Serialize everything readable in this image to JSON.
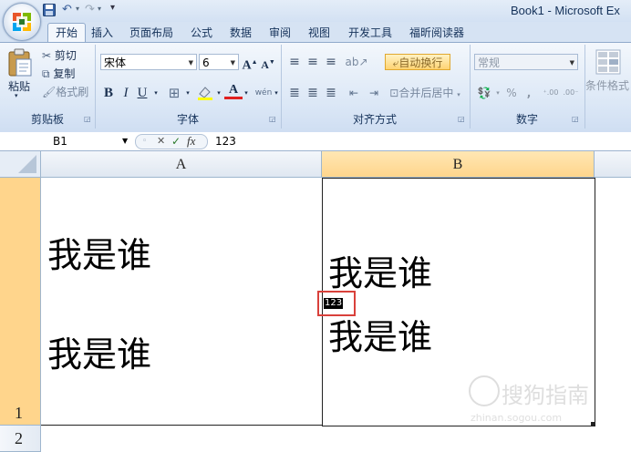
{
  "app": {
    "window_title": "Book1 - Microsoft Ex",
    "quick_access": {
      "undo_arrow": "▾",
      "redo_arrow": "▾",
      "customize": "▾"
    }
  },
  "tabs": [
    {
      "label": "开始"
    },
    {
      "label": "插入"
    },
    {
      "label": "页面布局"
    },
    {
      "label": "公式"
    },
    {
      "label": "数据"
    },
    {
      "label": "审阅"
    },
    {
      "label": "视图"
    },
    {
      "label": "开发工具"
    },
    {
      "label": "福昕阅读器"
    }
  ],
  "ribbon": {
    "clipboard": {
      "paste": "粘贴",
      "cut": "剪切",
      "copy": "复制",
      "format_painter": "格式刷",
      "group_label": "剪贴板"
    },
    "font": {
      "font_name": "宋体",
      "font_size": "6",
      "grow": "A",
      "shrink": "A",
      "bold": "B",
      "italic": "I",
      "underline": "U",
      "wen": "wén",
      "group_label": "字体"
    },
    "alignment": {
      "wrap_text": "自动换行",
      "merge_center": "合并后居中",
      "group_label": "对齐方式"
    },
    "number": {
      "format": "常规",
      "percent": "%",
      "comma": ",",
      "inc_decimal": ".00",
      "dec_decimal": ".00",
      "group_label": "数字"
    },
    "styles": {
      "conditional_format": "条件格式"
    }
  },
  "formula_bar": {
    "name_box": "B1",
    "cancel": "✕",
    "enter": "✓",
    "fx": "fx",
    "content": "123"
  },
  "grid": {
    "columns": [
      "A",
      "B"
    ],
    "rows": [
      "1",
      "2"
    ],
    "cells": {
      "A1_line1": "我是谁",
      "A1_line2": "我是谁",
      "B1_line1": "我是谁",
      "B1_editing": "123",
      "B1_line2": "我是谁"
    }
  },
  "watermark": {
    "text": "搜狗指南",
    "url": "zhinan.sogou.com"
  },
  "colors": {
    "accent_blue": "#15325a",
    "selected_header": "#ffd58c",
    "highlight_box": "#d9413b"
  }
}
